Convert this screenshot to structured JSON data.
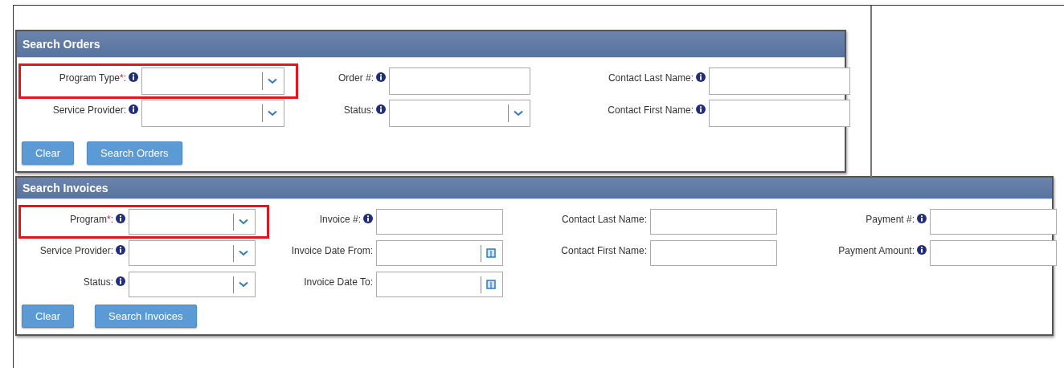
{
  "panels": [
    {
      "title": "Search Orders",
      "columns": [
        [
          {
            "label": "Program Type",
            "required_mark": "*",
            "label_end": ":",
            "info": true,
            "kind": "select",
            "highlighted": true
          },
          {
            "label": "Service Provider:",
            "info": true,
            "kind": "select",
            "highlighted": false
          }
        ],
        [
          {
            "label": "Order #:",
            "info": true,
            "kind": "text",
            "highlighted": false
          },
          {
            "label": "Status:",
            "info": true,
            "kind": "select",
            "highlighted": false
          }
        ],
        [
          {
            "label": "Contact Last Name:",
            "info": true,
            "kind": "text",
            "highlighted": false
          },
          {
            "label": "Contact First Name:",
            "info": true,
            "kind": "text",
            "highlighted": false
          }
        ]
      ],
      "buttons": [
        "Clear",
        "Search Orders"
      ]
    },
    {
      "title": "Search Invoices",
      "columns": [
        [
          {
            "label": "Program",
            "required_mark": "*",
            "label_end": ":",
            "info": true,
            "kind": "select",
            "highlighted": true
          },
          {
            "label": "Service Provider:",
            "info": true,
            "kind": "select",
            "highlighted": false
          },
          {
            "label": "Status:",
            "info": true,
            "kind": "select",
            "highlighted": false
          }
        ],
        [
          {
            "label": "Invoice #:",
            "info": true,
            "kind": "text",
            "highlighted": false
          },
          {
            "label": "Invoice Date From:",
            "info": false,
            "kind": "date",
            "highlighted": false
          },
          {
            "label": "Invoice Date To:",
            "info": false,
            "kind": "date",
            "highlighted": false
          }
        ],
        [
          {
            "label": "Contact Last Name:",
            "info": false,
            "kind": "text",
            "highlighted": false
          },
          {
            "label": "Contact First Name:",
            "info": false,
            "kind": "text",
            "highlighted": false
          }
        ],
        [
          {
            "label": "Payment #:",
            "info": true,
            "kind": "text",
            "highlighted": false
          },
          {
            "label": "Payment Amount:",
            "info": true,
            "kind": "text",
            "highlighted": false
          }
        ]
      ],
      "buttons": [
        "Clear",
        "Search Invoices"
      ]
    }
  ]
}
